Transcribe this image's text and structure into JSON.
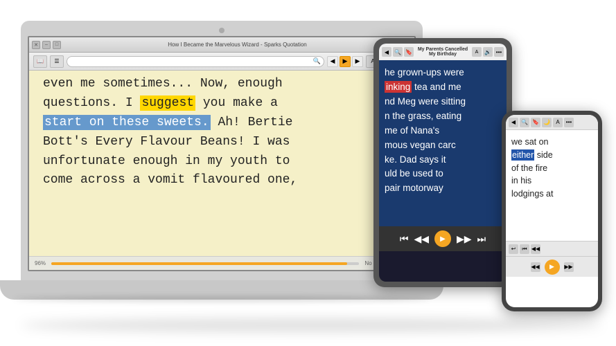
{
  "laptop": {
    "title": "How I Became the Marvelous Wizard - Sparks Quotation",
    "toolbar": {
      "play_label": "▶"
    },
    "content": {
      "line1": "even me sometimes... Now, enough",
      "line2": "questions. I ",
      "suggest_word": "suggest",
      "line2b": " you make a",
      "line3": "start on these sweets. Ah! Bertie",
      "line4": "Bott's Every Flavour Beans! I was",
      "line5": "unfortunate enough in my youth to",
      "line6": "come across a vomit flavoured one,"
    },
    "footer": {
      "progress_pct": "96%",
      "page_info": "No page numbers"
    }
  },
  "tablet": {
    "toolbar_title": "My Parents Cancelled My Birthday",
    "content": {
      "line1": "he grown-ups were",
      "drinking_word": "inking",
      "line1b": " tea and me",
      "line2": "nd Meg were sitting",
      "line3": "n the grass, eating",
      "line4": "me of Nana's",
      "line5": "mous vegan carc",
      "line6": "ke. Dad says it",
      "line7": "uld be used to",
      "line8": "pair motorway"
    }
  },
  "phone": {
    "content": {
      "line1": "we sat on",
      "either_word": "either",
      "line1b": " side",
      "line2": "of the fire",
      "line3": "in his",
      "line4": "lodgings at"
    }
  },
  "icons": {
    "back": "◀",
    "play": "▶",
    "forward": "▶▶",
    "rewind": "◀◀",
    "skip_back": "⏮",
    "skip_fwd": "⏭",
    "search": "🔍",
    "settings": "⚙"
  }
}
